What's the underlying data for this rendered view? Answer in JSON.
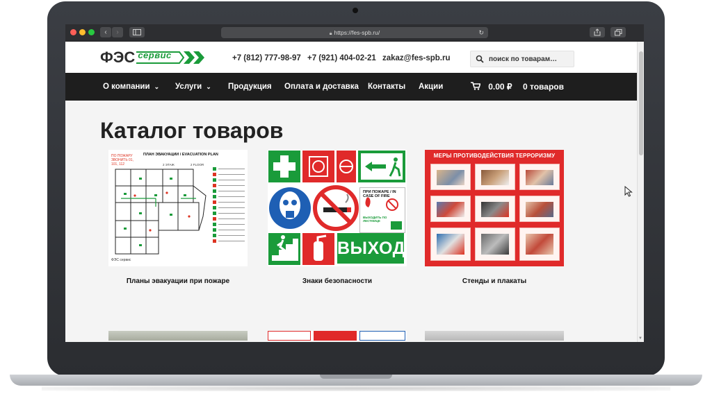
{
  "browser": {
    "url": "https://fes-spb.ru/"
  },
  "header": {
    "logo_main": "ФЭС",
    "logo_sub": "сервис",
    "phone_1": "+7 (812) 777-98-97",
    "phone_2": "+7 (921) 404-02-21",
    "email": "zakaz@fes-spb.ru",
    "search_placeholder": "поиск по товарам…"
  },
  "nav": {
    "items": [
      {
        "label": "О компании",
        "dropdown": true
      },
      {
        "label": "Услуги",
        "dropdown": true
      },
      {
        "label": "Продукция",
        "dropdown": false
      },
      {
        "label": "Оплата и доставка",
        "dropdown": false
      },
      {
        "label": "Контакты",
        "dropdown": false
      },
      {
        "label": "Акции",
        "dropdown": false
      }
    ],
    "cart_total": "0.00 ₽",
    "cart_count": "0 товаров"
  },
  "main": {
    "title": "Каталог товаров",
    "categories": [
      {
        "label": "Планы эвакуации при пожаре"
      },
      {
        "label": "Знаки безопасности"
      },
      {
        "label": "Стенды и плакаты"
      }
    ]
  },
  "images": {
    "evac_title": "ПЛАН ЭВАКУАЦИИ / EVACUATION PLAN",
    "evac_floor_1": "2 ЭТАЖ",
    "evac_floor_2": "2 FLOOR",
    "evac_red_note": "ПО ПОЖАРУ ЗВОНИТЬ 01, 101, 112",
    "evac_footer": "ФЭС сервис",
    "exit_sign": "ВЫХОД",
    "fire_sign_text": "ПРИ ПОЖАРЕ / IN CASE OF FIRE",
    "fire_sign_text2": "ВЫХОДИТЬ ПО ЛЕСТНИЦЕ",
    "stands_title": "МЕРЫ ПРОТИВОДЕЙСТВИЯ ТЕРРОРИЗМУ"
  },
  "colors": {
    "nav_bg": "#1e1e1e",
    "brand_green": "#1a9b3a",
    "safety_red": "#e02a2a"
  }
}
